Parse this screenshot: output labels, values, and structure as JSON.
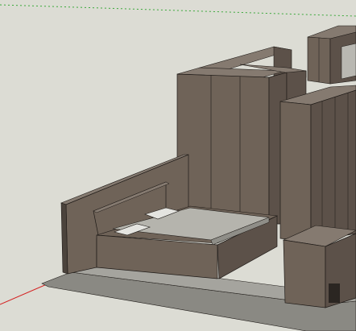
{
  "viewport": {
    "background": "#dcdcd4",
    "axis_colors": {
      "x_red": "#d42020",
      "y_green": "#3aa83a"
    }
  },
  "scene": {
    "colors": {
      "panel_front": "#6f6358",
      "panel_side": "#5c5149",
      "panel_top": "#857a70",
      "panel_dark": "#4b433c",
      "floor_rug": "#aaa9a3",
      "floor_edge": "#8a8983",
      "mattress_top": "#b5b4ad",
      "mattress_side": "#8f8e88",
      "pillow": "#e4e4e0",
      "edge_line": "#1e1a17"
    },
    "objects": [
      "floor-slab",
      "wall-left-panel",
      "wardrobe-tall",
      "wardrobe-right-stack",
      "headboard",
      "bed-frame",
      "mattress",
      "pillow-left",
      "pillow-right",
      "nightstand",
      "back-shelves"
    ]
  }
}
